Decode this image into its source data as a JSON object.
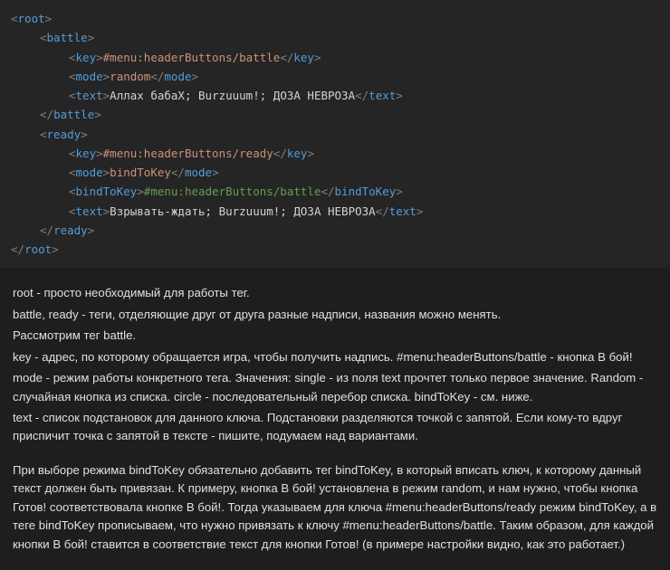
{
  "code": {
    "lines": [
      {
        "indent": 0,
        "segments": [
          {
            "c": "tag",
            "t": "<"
          },
          {
            "c": "tagname",
            "t": "root"
          },
          {
            "c": "tag",
            "t": ">"
          }
        ]
      },
      {
        "indent": 1,
        "segments": [
          {
            "c": "tag",
            "t": "<"
          },
          {
            "c": "tagname",
            "t": "battle"
          },
          {
            "c": "tag",
            "t": ">"
          }
        ]
      },
      {
        "indent": 2,
        "segments": [
          {
            "c": "tag",
            "t": "<"
          },
          {
            "c": "tagname",
            "t": "key"
          },
          {
            "c": "tag",
            "t": ">"
          },
          {
            "c": "val-orange",
            "t": "#menu:headerButtons/battle"
          },
          {
            "c": "tag",
            "t": "</"
          },
          {
            "c": "tagname",
            "t": "key"
          },
          {
            "c": "tag",
            "t": ">"
          }
        ]
      },
      {
        "indent": 2,
        "segments": [
          {
            "c": "tag",
            "t": "<"
          },
          {
            "c": "tagname",
            "t": "mode"
          },
          {
            "c": "tag",
            "t": ">"
          },
          {
            "c": "val-orange",
            "t": "random"
          },
          {
            "c": "tag",
            "t": "</"
          },
          {
            "c": "tagname",
            "t": "mode"
          },
          {
            "c": "tag",
            "t": ">"
          }
        ]
      },
      {
        "indent": 2,
        "segments": [
          {
            "c": "tag",
            "t": "<"
          },
          {
            "c": "tagname",
            "t": "text"
          },
          {
            "c": "tag",
            "t": ">"
          },
          {
            "c": "val-white",
            "t": "Аллах бабаХ; Burzuuum!; ДОЗА НЕВРОЗА"
          },
          {
            "c": "tag",
            "t": "</"
          },
          {
            "c": "tagname",
            "t": "text"
          },
          {
            "c": "tag",
            "t": ">"
          }
        ]
      },
      {
        "indent": 1,
        "segments": [
          {
            "c": "tag",
            "t": "</"
          },
          {
            "c": "tagname",
            "t": "battle"
          },
          {
            "c": "tag",
            "t": ">"
          }
        ]
      },
      {
        "indent": 1,
        "segments": [
          {
            "c": "tag",
            "t": "<"
          },
          {
            "c": "tagname",
            "t": "ready"
          },
          {
            "c": "tag",
            "t": ">"
          }
        ]
      },
      {
        "indent": 2,
        "segments": [
          {
            "c": "tag",
            "t": "<"
          },
          {
            "c": "tagname",
            "t": "key"
          },
          {
            "c": "tag",
            "t": ">"
          },
          {
            "c": "val-orange",
            "t": "#menu:headerButtons/ready"
          },
          {
            "c": "tag",
            "t": "</"
          },
          {
            "c": "tagname",
            "t": "key"
          },
          {
            "c": "tag",
            "t": ">"
          }
        ]
      },
      {
        "indent": 2,
        "segments": [
          {
            "c": "tag",
            "t": "<"
          },
          {
            "c": "tagname",
            "t": "mode"
          },
          {
            "c": "tag",
            "t": ">"
          },
          {
            "c": "val-orange",
            "t": "bindToKey"
          },
          {
            "c": "tag",
            "t": "</"
          },
          {
            "c": "tagname",
            "t": "mode"
          },
          {
            "c": "tag",
            "t": ">"
          }
        ]
      },
      {
        "indent": 2,
        "segments": [
          {
            "c": "tag",
            "t": "<"
          },
          {
            "c": "tagname",
            "t": "bindToKey"
          },
          {
            "c": "tag",
            "t": ">"
          },
          {
            "c": "val-green",
            "t": "#menu:headerButtons/battle"
          },
          {
            "c": "tag",
            "t": "</"
          },
          {
            "c": "tagname",
            "t": "bindToKey"
          },
          {
            "c": "tag",
            "t": ">"
          }
        ]
      },
      {
        "indent": 2,
        "segments": [
          {
            "c": "tag",
            "t": "<"
          },
          {
            "c": "tagname",
            "t": "text"
          },
          {
            "c": "tag",
            "t": ">"
          },
          {
            "c": "val-white",
            "t": "Взрывать-ждать; Burzuuum!; ДОЗА НЕВРОЗА"
          },
          {
            "c": "tag",
            "t": "</"
          },
          {
            "c": "tagname",
            "t": "text"
          },
          {
            "c": "tag",
            "t": ">"
          }
        ]
      },
      {
        "indent": 1,
        "segments": [
          {
            "c": "tag",
            "t": "</"
          },
          {
            "c": "tagname",
            "t": "ready"
          },
          {
            "c": "tag",
            "t": ">"
          }
        ]
      },
      {
        "indent": 0,
        "segments": [
          {
            "c": "tag",
            "t": "</"
          },
          {
            "c": "tagname",
            "t": "root"
          },
          {
            "c": "tag",
            "t": ">"
          }
        ]
      }
    ]
  },
  "doc": {
    "p1": "root - просто необходимый для работы тег.",
    "p2": "battle, ready - теги, отделяющие друг от друга разные надписи, названия можно менять.",
    "p3": "Рассмотрим тег battle.",
    "p4": "key - адрес, по которому обращается игра, чтобы получить надпись. #menu:headerButtons/battle - кнопка В бой!",
    "p5": "mode - режим работы конкретного тега. Значения: single - из поля text прочтет только первое значение. Random - случайная кнопка из списка. circle - последовательный перебор списка. bindToKey - см. ниже.",
    "p6": "text - список подстановок для данного ключа. Подстановки разделяются точкой с запятой. Если кому-то вдруг приспичит точка с запятой в тексте - пишите, подумаем над вариантами.",
    "p7": "При выборе режима bindToKey обязательно добавить тег bindToKey, в который вписать ключ, к которому данный текст должен быть привязан. К примеру, кнопка В бой! установлена в режим random, и нам нужно, чтобы кнопка Готов! соответствовала кнопке В бой!. Тогда указываем для ключа #menu:headerButtons/ready режим bindToKey, а в теге bindToKey прописываем, что нужно привязать к ключу #menu:headerButtons/battle. Таким образом, для каждой кнопки В бой! ставится в соответствие текст для кнопки Готов! (в примере настройки видно, как это работает.)"
  }
}
